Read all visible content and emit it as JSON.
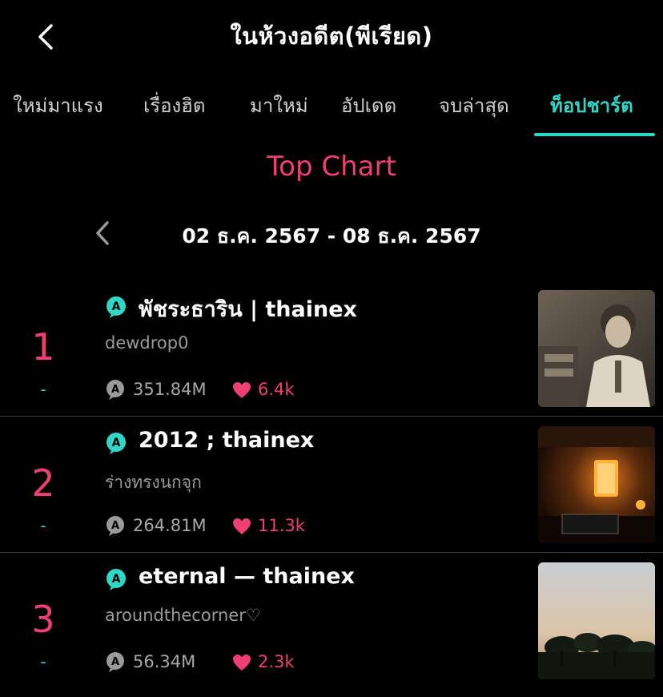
{
  "header": {
    "title": "ในห้วงอดีต(พีเรียด)"
  },
  "tabs": [
    {
      "label": "ใหม่มาแรง"
    },
    {
      "label": "เรื่องฮิต"
    },
    {
      "label": "มาใหม่"
    },
    {
      "label": "อัปเดต"
    },
    {
      "label": "จบล่าสุด"
    },
    {
      "label": "ท็อปชาร์ต",
      "active": true
    }
  ],
  "chart": {
    "heading": "Top Chart",
    "date_range": "02 ธ.ค. 2567 - 08 ธ.ค. 2567"
  },
  "stories": [
    {
      "rank": "1",
      "change": "-",
      "title": "พัชระธาริน | thainex",
      "author": "dewdrop0",
      "views": "351.84M",
      "likes": "6.4k"
    },
    {
      "rank": "2",
      "change": "-",
      "title": "2012 ; thainex",
      "author": "ร่างทรงนกจุก",
      "views": "264.81M",
      "likes": "11.3k"
    },
    {
      "rank": "3",
      "change": "-",
      "title": "eternal — thainex",
      "author": "aroundthecorner♡",
      "views": "56.34M",
      "likes": "2.3k"
    }
  ],
  "colors": {
    "accent_teal": "#2fd7c7",
    "accent_pink": "#ee3f72",
    "background": "#000000"
  },
  "icons": {
    "back": "chevron-left-icon",
    "badge": "story-badge-icon",
    "views": "views-icon",
    "likes": "heart-icon"
  }
}
